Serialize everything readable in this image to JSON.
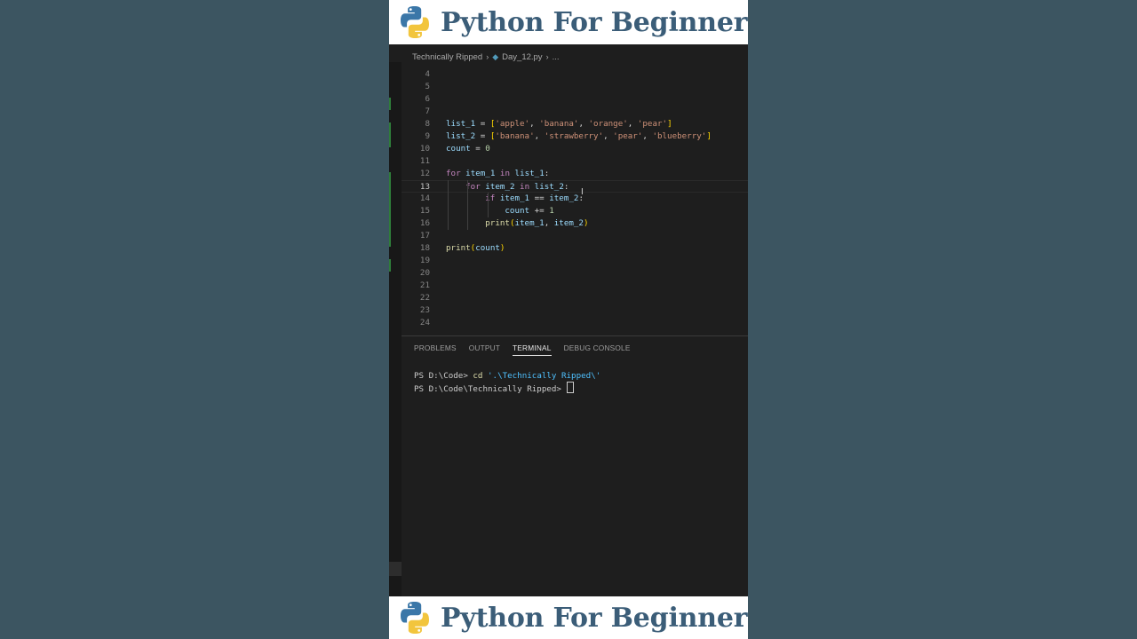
{
  "banner": {
    "title": "Python For Beginners"
  },
  "breadcrumb": {
    "folder": "Technically Ripped",
    "file": "Day_12.py",
    "ellipsis": "..."
  },
  "editor": {
    "lines": [
      {
        "n": "4",
        "html": ""
      },
      {
        "n": "5",
        "html": ""
      },
      {
        "n": "6",
        "html": ""
      },
      {
        "n": "7",
        "html": ""
      },
      {
        "n": "8",
        "html": "<span class=\"tok-var\">list_1</span> = <span class=\"tok-br\">[</span><span class=\"tok-str\">'apple'</span>, <span class=\"tok-str\">'banana'</span>, <span class=\"tok-str\">'orange'</span>, <span class=\"tok-str\">'pear'</span><span class=\"tok-br\">]</span>"
      },
      {
        "n": "9",
        "html": "<span class=\"tok-var\">list_2</span> = <span class=\"tok-br\">[</span><span class=\"tok-str\">'banana'</span>, <span class=\"tok-str\">'strawberry'</span>, <span class=\"tok-str\">'pear'</span>, <span class=\"tok-str\">'blueberry'</span><span class=\"tok-br\">]</span>"
      },
      {
        "n": "10",
        "html": "<span class=\"tok-var\">count</span> = <span class=\"tok-num\">0</span>"
      },
      {
        "n": "11",
        "html": ""
      },
      {
        "n": "12",
        "html": "<span class=\"tok-kw\">for</span> <span class=\"tok-var\">item_1</span> <span class=\"tok-kw\">in</span> <span class=\"tok-var\">list_1</span>:"
      },
      {
        "n": "13",
        "html": "    <span class=\"tok-kw\">for</span> <span class=\"tok-var\">item_2</span> <span class=\"tok-kw\">in</span> <span class=\"tok-var\">list_2</span>:"
      },
      {
        "n": "14",
        "html": "        <span class=\"tok-kw\">if</span> <span class=\"tok-var\">item_1</span> == <span class=\"tok-var\">item_2</span>:"
      },
      {
        "n": "15",
        "html": "            <span class=\"tok-var\">count</span> += <span class=\"tok-num\">1</span>"
      },
      {
        "n": "16",
        "html": "        <span class=\"tok-fn\">print</span><span class=\"tok-br\">(</span><span class=\"tok-var\">item_1</span>, <span class=\"tok-var\">item_2</span><span class=\"tok-br\">)</span>"
      },
      {
        "n": "17",
        "html": ""
      },
      {
        "n": "18",
        "html": "<span class=\"tok-fn\">print</span><span class=\"tok-br\">(</span><span class=\"tok-var\">count</span><span class=\"tok-br\">)</span>"
      },
      {
        "n": "19",
        "html": ""
      },
      {
        "n": "20",
        "html": ""
      },
      {
        "n": "21",
        "html": ""
      },
      {
        "n": "22",
        "html": ""
      },
      {
        "n": "23",
        "html": ""
      },
      {
        "n": "24",
        "html": ""
      }
    ],
    "active_line": "13"
  },
  "panel": {
    "tabs": [
      "PROBLEMS",
      "OUTPUT",
      "TERMINAL",
      "DEBUG CONSOLE"
    ],
    "active_tab": "TERMINAL"
  },
  "terminal": {
    "line1_prompt": "PS D:\\Code> ",
    "line1_cmd": "cd",
    "line1_arg": "'.\\Technically Ripped\\'",
    "line2_prompt": "PS D:\\Code\\Technically Ripped> "
  },
  "colors": {
    "background": "#3c5561",
    "banner_text": "#3b5d78",
    "editor_bg": "#1e1e1e"
  }
}
